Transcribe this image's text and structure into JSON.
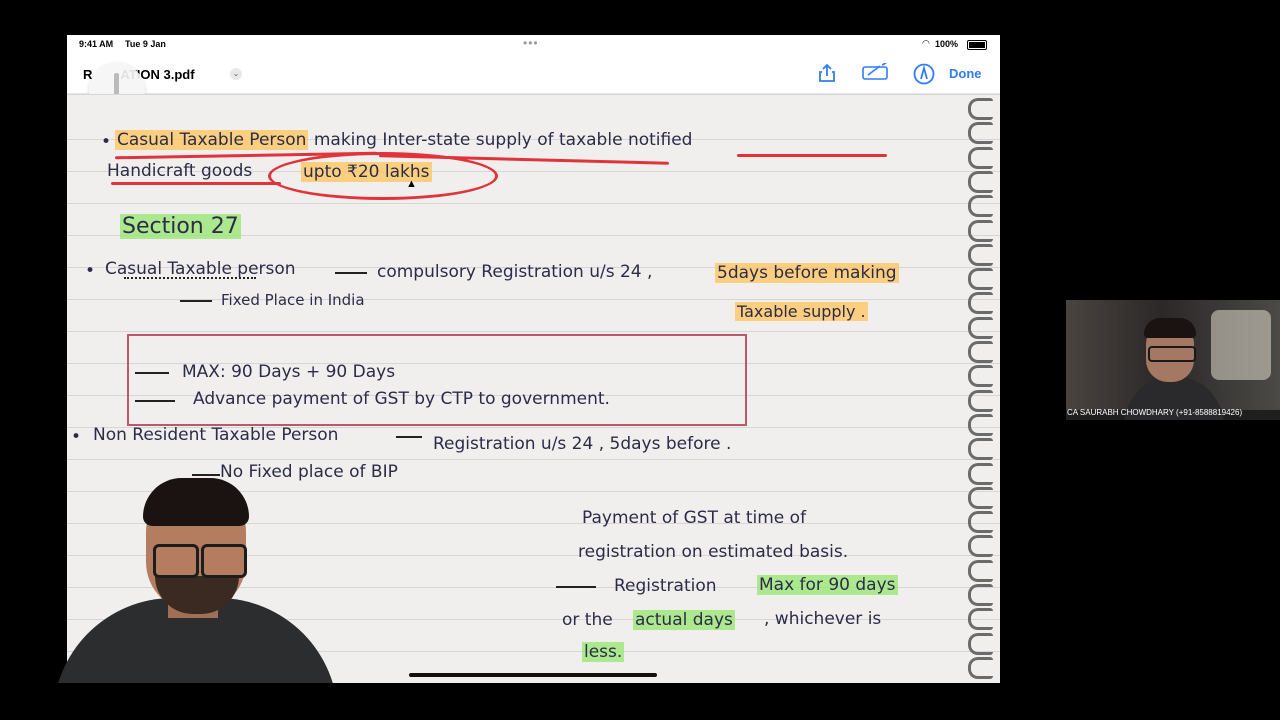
{
  "status_bar": {
    "time": "9:41 AM",
    "date": "Tue 9 Jan",
    "battery": "100%"
  },
  "toolbar": {
    "file_title": "ATION 3.pdf",
    "title_prefix": "R",
    "done_label": "Done"
  },
  "icons": {
    "share": "share-icon",
    "markup": "markup-icon",
    "pencil": "pencil-circle-icon",
    "chevron": "chevron-down-icon"
  },
  "notes": {
    "bullet1_line1": [
      "Casual Taxable Person",
      "making",
      "Inter-state supply of",
      "taxable notified"
    ],
    "bullet1_line2_pre": "Handicraft goods",
    "bullet1_line2_circ": "upto ₹20 lakhs",
    "section_heading": "Section 27",
    "casual_label": "Casual Taxable person",
    "casual_rest": "compulsory Registration u/s 24 ,",
    "casual_hl": "5days before making",
    "fixed_place": "Fixed Place in India",
    "taxable_supply": "Taxable supply .",
    "box_line1": "MAX: 90 Days + 90 Days",
    "box_line2": "Advance payment of GST by CTP to government.",
    "nonres_line": "Non Resident Taxable Person",
    "nonres_rest": "Registration u/s 24 , 5days before .",
    "no_fixed": "No Fixed place of BIP",
    "pay_line1": "Payment of GST at time of",
    "pay_line2": "registration on estimated basis.",
    "reg_pre": "Registration",
    "reg_hl": "Max for 90 days",
    "or_the": "or the",
    "actual_days": "actual days",
    "whichever": ", whichever is",
    "less": "less."
  },
  "participant": {
    "name": "CA SAURABH CHOWDHARY (+91-8588819426)"
  },
  "colors": {
    "accent": "#2f7cf6",
    "red_ink": "#e0343a",
    "highlight_orange": "#ffc45a",
    "highlight_green": "#96e66e"
  }
}
